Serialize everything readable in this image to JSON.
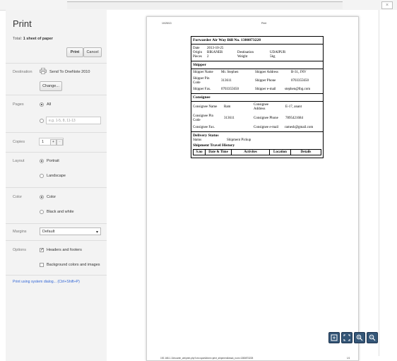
{
  "sidebar": {
    "title": "Print",
    "total_prefix": "Total:",
    "total_value": "1 sheet of paper",
    "print_button": "Print",
    "cancel_button": "Cancel",
    "destination_label": "Destination",
    "destination_value": "Send To OneNote 2010",
    "change_button": "Change...",
    "pages_label": "Pages",
    "pages_all": "All",
    "pages_placeholder": "e.g. 1-5, 8, 11-13",
    "copies_label": "Copies",
    "copies_value": "1",
    "copies_plus": "+",
    "copies_minus": "−",
    "layout_label": "Layout",
    "layout_portrait": "Portrait",
    "layout_landscape": "Landscape",
    "color_label": "Color",
    "color_color": "Color",
    "color_bw": "Black and white",
    "margins_label": "Margins",
    "margins_value": "Default",
    "options_label": "Options",
    "opt_headers": "Headers and footers",
    "opt_background": "Background colors and images",
    "system_dialog_link": "Print using system dialog... (Ctrl+Shift+P)"
  },
  "preview": {
    "header_date": "10/25/13",
    "header_title": "Print",
    "footer_url": "192.168.1.10/courier_wb/print.php?cm=sport&form=print_shipment&track_num=1380873228",
    "footer_page": "1/1",
    "doc": {
      "title": "Forwarder Air Way Bill No. 1380873228",
      "date_label": "Date",
      "date_value": "2013-10-25",
      "origin_label": "Origin",
      "origin_value": "BIKANER",
      "destination_label": "Destination",
      "destination_value": "UDAIPUR",
      "pieces_label": "Pieces",
      "pieces_value": "2",
      "weight_label": "Weight",
      "weight_value": "5kg",
      "shipper_header": "Shipper",
      "shipper_name_label": "Shipper Name",
      "shipper_name_value": "Mr. Stephen",
      "shipper_address_label": "Shipper Address",
      "shipper_address_value": "B-31, JNV",
      "shipper_pin_label": "Shipper Pin Code",
      "shipper_pin_value": "313611",
      "shipper_phone_label": "Shipper Phone",
      "shipper_phone_value": "0703355650",
      "shipper_fax_label": "Shipper Fax.",
      "shipper_fax_value": "0703355650",
      "shipper_email_label": "Shipper e-mail",
      "shipper_email_value": "stephen@lbg.com",
      "consignee_header": "Consignee",
      "consignee_name_label": "Consignee Name",
      "consignee_name_value": "Ram",
      "consignee_address_label": "Consignee Address",
      "consignee_address_value": "E-17, anant",
      "consignee_pin_label": "Consignee Pin Code",
      "consignee_pin_value": "313611",
      "consignee_phone_label": "Consignee Phone",
      "consignee_phone_value": "7895421684",
      "consignee_fax_label": "Consignee Fax.",
      "consignee_email_label": "Consignee e-mail",
      "consignee_email_value": "ramesh@gmail.com",
      "delivery_header": "Delivery Status",
      "status_label": "Status",
      "status_value": "Shipment Pickup",
      "history_header": "Shipment Travel History",
      "history_columns": [
        "S.no",
        "Date & Time",
        "Activites",
        "Location",
        "Details"
      ]
    }
  },
  "tools": {
    "fit_icon": "fit-page-icon",
    "fullscreen_icon": "fullscreen-icon",
    "zoom_in_icon": "zoom-in-icon",
    "zoom_out_icon": "zoom-out-icon"
  }
}
